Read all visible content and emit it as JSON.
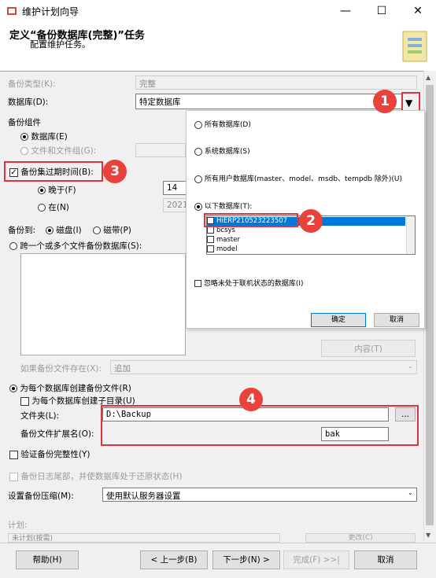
{
  "window": {
    "title": "维护计划向导",
    "minimize": "—",
    "maximize": "☐",
    "close": "✕"
  },
  "header": {
    "title": "定义“备份数据库(完整)”任务",
    "subtitle": "配置维护任务。"
  },
  "form": {
    "backup_type_label": "备份类型(K):",
    "backup_type_value": "完整",
    "database_label": "数据库(D):",
    "database_value": "特定数据库",
    "component_label": "备份组件",
    "component_db": "数据库(E)",
    "component_files": "文件和文件组(G):",
    "expire_label": "备份集过期时间(B):",
    "expire_after": "晚于(F)",
    "expire_after_value": "14",
    "expire_on": "在(N)",
    "expire_on_value": "2021/",
    "backup_to_label": "备份到:",
    "disk": "磁盘(I)",
    "tape": "磁带(P)",
    "across_files": "跨一个或多个文件备份数据库(S):",
    "content_button": "内容(T)",
    "if_exists_label": "如果备份文件存在(X):",
    "if_exists_value": "追加",
    "per_db_file": "为每个数据库创建备份文件(R)",
    "per_db_subdir": "为每个数据库创建子目录(U)",
    "folder_label": "文件夹(L):",
    "folder_value": "D:\\Backup",
    "browse_button": "...",
    "ext_label": "备份文件扩展名(O):",
    "ext_value": "bak",
    "verify": "验证备份完整性(Y)",
    "tail_log": "备份日志尾部，并使数据库处于还原状态(H)",
    "compression_label": "设置备份压缩(M):",
    "compression_value": "使用默认服务器设置",
    "schedule_label": "计划:",
    "schedule_value": "未计划(按需)",
    "change_button": "更改(C)"
  },
  "popup": {
    "all_dbs": "所有数据库(D)",
    "system_dbs": "系统数据库(S)",
    "user_dbs": "所有用户数据库(master、model、msdb、tempdb 除外)(U)",
    "these_dbs": "以下数据库(T):",
    "databases": [
      "HiERP210523223507",
      "bcsys",
      "master",
      "model"
    ],
    "ignore_offline": "忽略未处于联机状态的数据库(I)",
    "ok": "确定",
    "cancel": "取消"
  },
  "badges": {
    "b1": "1",
    "b2": "2",
    "b3": "3",
    "b4": "4"
  },
  "footer": {
    "help": "帮助(H)",
    "back": "< 上一步(B)",
    "next": "下一步(N) >",
    "finish": "完成(F) >>|",
    "cancel": "取消"
  },
  "colors": {
    "annotation_red": "#e0323a",
    "selection_blue": "#0078d7"
  }
}
